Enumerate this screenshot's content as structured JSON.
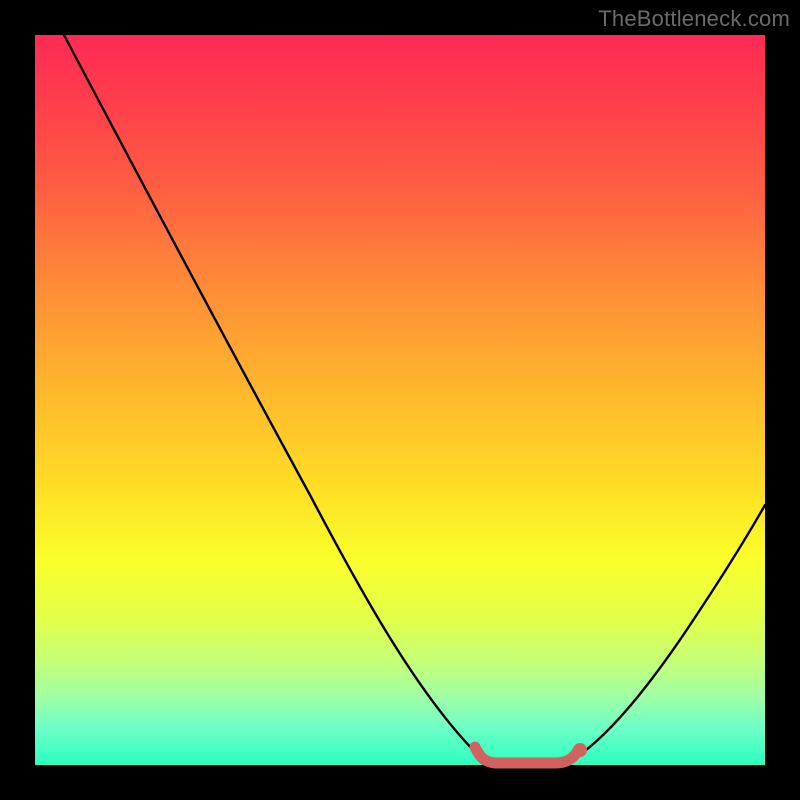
{
  "watermark": "TheBottleneck.com",
  "colors": {
    "curve_stroke": "#000000",
    "marker_stroke": "#d1625e",
    "marker_fill": "#d1625e"
  },
  "chart_data": {
    "type": "line",
    "title": "",
    "xlabel": "",
    "ylabel": "",
    "xlim": [
      0,
      100
    ],
    "ylim": [
      0,
      100
    ],
    "series": [
      {
        "name": "bottleneck-curve",
        "x": [
          4,
          8,
          12,
          16,
          20,
          24,
          28,
          32,
          36,
          40,
          44,
          48,
          52,
          56,
          60,
          62,
          64,
          66,
          70,
          72,
          74,
          78,
          82,
          86,
          90,
          94,
          98,
          100
        ],
        "y": [
          100,
          93,
          86,
          79,
          72,
          65,
          59,
          52,
          45,
          39,
          33,
          27,
          21,
          15,
          9,
          5,
          2,
          0,
          0,
          1,
          3,
          8,
          14,
          20,
          27,
          34,
          41,
          45
        ]
      }
    ],
    "annotations": [
      {
        "name": "valley-highlight",
        "x_range": [
          62,
          74
        ],
        "y": 0
      },
      {
        "name": "valley-end-dot",
        "x": 74,
        "y": 2
      }
    ]
  }
}
